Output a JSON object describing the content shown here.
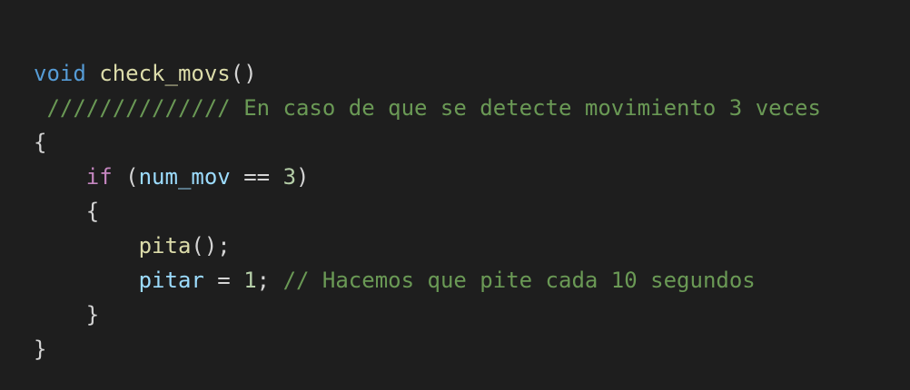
{
  "code": {
    "line1": {
      "keyword": "void",
      "space": " ",
      "function": "check_movs",
      "paren": "()"
    },
    "line2": {
      "comment": " ////////////// En caso de que se detecte movimiento 3 veces"
    },
    "line3": {
      "brace": "{"
    },
    "line4": {
      "indent": "    ",
      "keyword": "if",
      "open": " (",
      "variable": "num_mov",
      "operator": " == ",
      "number": "3",
      "close": ")"
    },
    "line5": {
      "indent": "    ",
      "brace": "{"
    },
    "line6": {
      "indent": "        ",
      "function": "pita",
      "rest": "();"
    },
    "line7": {
      "indent": "        ",
      "variable": "pitar",
      "operator": " = ",
      "number": "1",
      "semicolon": "; ",
      "comment": "// Hacemos que pite cada 10 segundos"
    },
    "line8": {
      "indent": "    ",
      "brace": "}"
    },
    "line9": {
      "brace": "}"
    }
  },
  "colors": {
    "background": "#1e1e1e",
    "default_text": "#d4d4d4",
    "keyword_blue": "#569cd6",
    "keyword_purple": "#c586c0",
    "function": "#dcdcaa",
    "variable": "#9cdcfe",
    "number": "#b5cea8",
    "comment": "#6a9955"
  }
}
